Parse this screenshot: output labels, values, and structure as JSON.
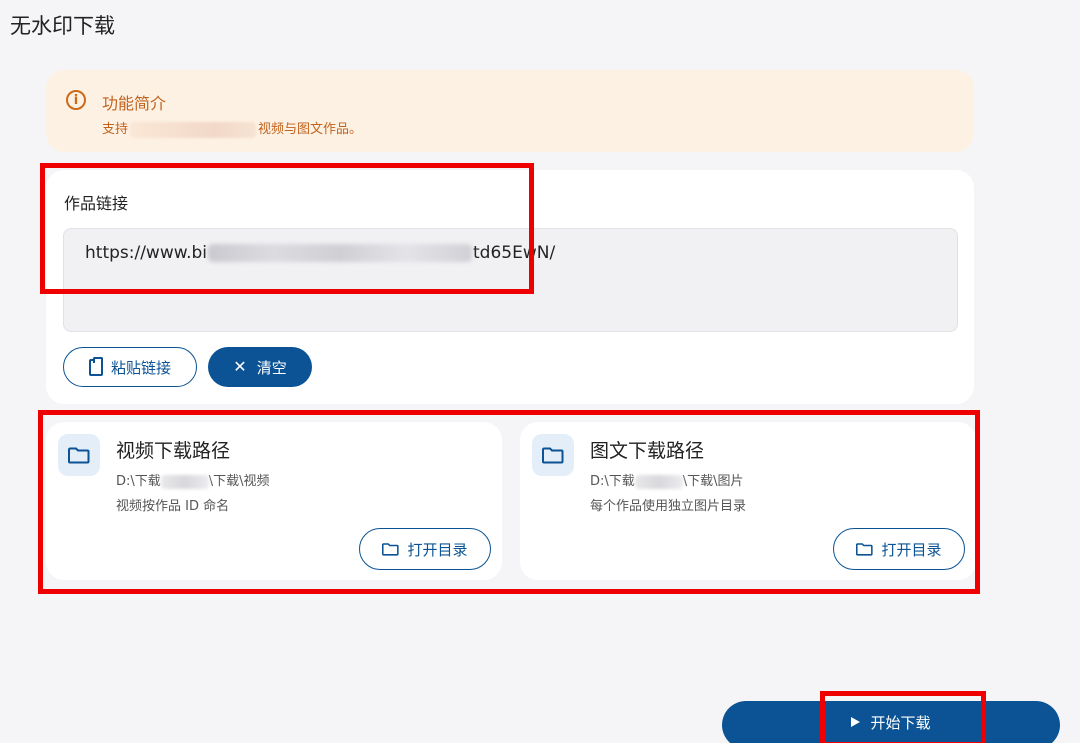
{
  "page": {
    "title": "无水印下载"
  },
  "notice": {
    "icon": "info-icon",
    "title": "功能简介",
    "text_prefix": "支持",
    "text_suffix": "视频与图文作品。"
  },
  "link": {
    "label": "作品链接",
    "url_prefix": "https://www.bi",
    "url_suffix": "td65EwN/",
    "paste_label": "粘贴链接",
    "clear_label": "清空"
  },
  "video_path": {
    "title": "视频下载路径",
    "dir_prefix": "D:\\下载",
    "dir_suffix": "\\下载\\视频",
    "note": "视频按作品 ID 命名",
    "open_label": "打开目录"
  },
  "image_path": {
    "title": "图文下载路径",
    "dir_prefix": "D:\\下载",
    "dir_suffix": "\\下载\\图片",
    "note": "每个作品使用独立图片目录",
    "open_label": "打开目录"
  },
  "actions": {
    "start_label": "开始下载"
  },
  "colors": {
    "accent": "#0b5394",
    "notice_bg": "#fdf1e3",
    "notice_text": "#c2621c",
    "highlight": "#ee0000"
  }
}
